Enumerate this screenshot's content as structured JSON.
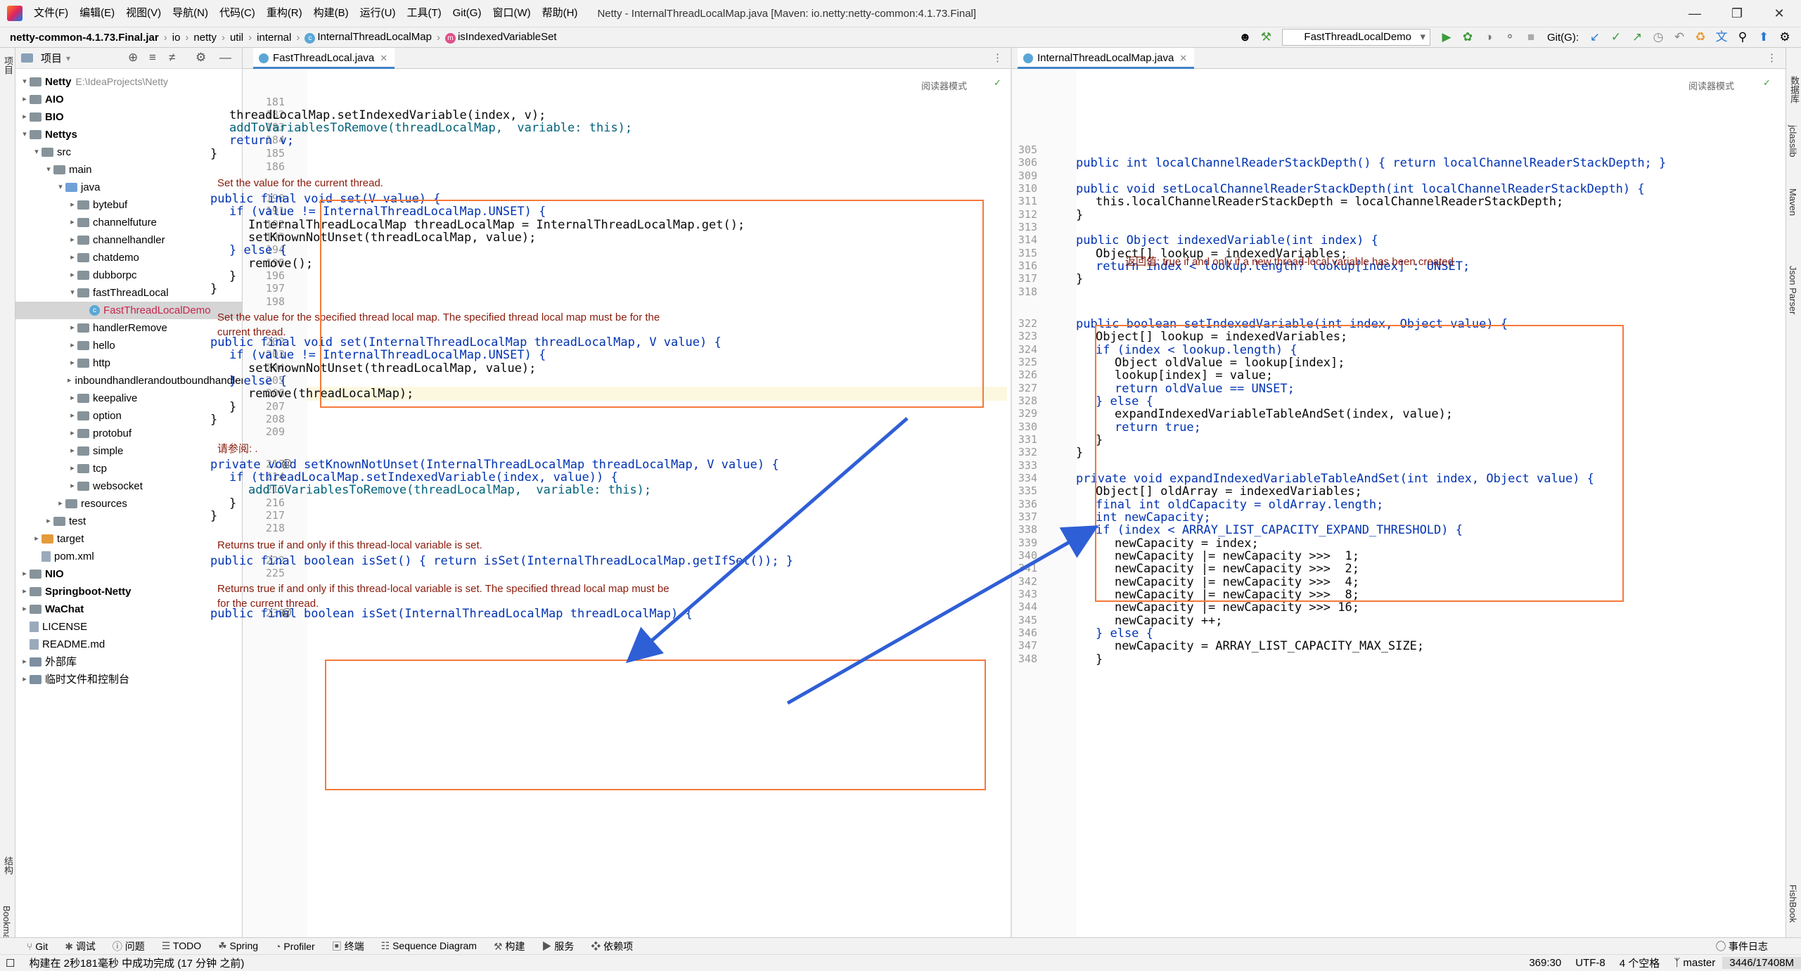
{
  "menubar": {
    "items": [
      "文件(F)",
      "编辑(E)",
      "视图(V)",
      "导航(N)",
      "代码(C)",
      "重构(R)",
      "构建(B)",
      "运行(U)",
      "工具(T)",
      "Git(G)",
      "窗口(W)",
      "帮助(H)"
    ],
    "title": "Netty - InternalThreadLocalMap.java [Maven: io.netty:netty-common:4.1.73.Final]"
  },
  "breadcrumb": [
    "netty-common-4.1.73.Final.jar",
    "io",
    "netty",
    "util",
    "internal",
    "InternalThreadLocalMap",
    "isIndexedVariableSet"
  ],
  "toolbar": {
    "run_config": "FastThreadLocalDemo",
    "git_label": "Git(G):"
  },
  "project": {
    "header": "项目",
    "tree": [
      {
        "t": "Netty",
        "path": "E:\\IdeaProjects\\Netty",
        "bold": true
      },
      {
        "t": "AIO",
        "bold": true
      },
      {
        "t": "BIO",
        "bold": true
      },
      {
        "t": "Nettys",
        "bold": true
      },
      {
        "t": "src"
      },
      {
        "t": "main"
      },
      {
        "t": "java"
      },
      {
        "t": "bytebuf"
      },
      {
        "t": "channelfuture"
      },
      {
        "t": "channelhandler"
      },
      {
        "t": "chatdemo"
      },
      {
        "t": "dubborpc"
      },
      {
        "t": "fastThreadLocal"
      },
      {
        "t": "FastThreadLocalDemo"
      },
      {
        "t": "handlerRemove"
      },
      {
        "t": "hello"
      },
      {
        "t": "http"
      },
      {
        "t": "inboundhandlerandoutboundhandler"
      },
      {
        "t": "keepalive"
      },
      {
        "t": "option"
      },
      {
        "t": "protobuf"
      },
      {
        "t": "simple"
      },
      {
        "t": "tcp"
      },
      {
        "t": "websocket"
      },
      {
        "t": "resources"
      },
      {
        "t": "test"
      },
      {
        "t": "target"
      },
      {
        "t": "pom.xml"
      },
      {
        "t": "NIO",
        "bold": true
      },
      {
        "t": "Springboot-Netty",
        "bold": true
      },
      {
        "t": "WaChat",
        "bold": true
      },
      {
        "t": "LICENSE"
      },
      {
        "t": "README.md"
      },
      {
        "t": "外部库"
      },
      {
        "t": "临时文件和控制台"
      }
    ]
  },
  "left_editor": {
    "tab": "FastThreadLocal.java",
    "reader": "阅读器模式",
    "line_numbers": [
      "181",
      "182",
      "183",
      "184",
      "185",
      "186",
      "190",
      "191",
      "192",
      "193",
      "194",
      "195",
      "196",
      "197",
      "198",
      "202",
      "203",
      "204",
      "205",
      "206",
      "207",
      "208",
      "209",
      "213",
      "214",
      "215",
      "216",
      "217",
      "218",
      "222",
      "225",
      "230"
    ],
    "docs": [
      "Set the value for the current thread.",
      "Set the value for the specified thread local map. The specified thread local map must be for the\ncurrent thread.",
      "请参阅: .",
      "Returns true if and only if this thread-local variable is set.",
      "Returns true if and only if this thread-local variable is set. The specified thread local map must be\nfor the current thread."
    ],
    "code": [
      "threadLocalMap.setIndexedVariable(index, v);",
      "addToVariablesToRemove(threadLocalMap,  variable: this);",
      "return v;",
      "}",
      "public final void set(V value) {",
      "if (value != InternalThreadLocalMap.UNSET) {",
      "InternalThreadLocalMap threadLocalMap = InternalThreadLocalMap.get();",
      "setKnownNotUnset(threadLocalMap, value);",
      "} else {",
      "remove();",
      "}",
      "}",
      "public final void set(InternalThreadLocalMap threadLocalMap, V value) {",
      "if (value != InternalThreadLocalMap.UNSET) {",
      "setKnownNotUnset(threadLocalMap, value);",
      "} else {",
      "remove(threadLocalMap);",
      "}",
      "}",
      "private void setKnownNotUnset(InternalThreadLocalMap threadLocalMap, V value) {",
      "if (threadLocalMap.setIndexedVariable(index, value)) {",
      "addToVariablesToRemove(threadLocalMap,  variable: this);",
      "}",
      "}",
      "public final boolean isSet() { return isSet(InternalThreadLocalMap.getIfSet()); }",
      "public final boolean isSet(InternalThreadLocalMap threadLocalMap) {"
    ]
  },
  "right_editor": {
    "tab": "InternalThreadLocalMap.java",
    "reader": "阅读器模式",
    "line_numbers": [
      "305",
      "306",
      "309",
      "310",
      "311",
      "312",
      "313",
      "314",
      "315",
      "316",
      "317",
      "318",
      "322",
      "323",
      "324",
      "325",
      "326",
      "327",
      "328",
      "329",
      "330",
      "331",
      "332",
      "333",
      "334",
      "335",
      "336",
      "337",
      "338",
      "339",
      "340",
      "341",
      "342",
      "343",
      "344",
      "345",
      "346",
      "347",
      "348"
    ],
    "doc": "返回值: true if and only if a new thread-local variable has been created",
    "code": [
      "public int localChannelReaderStackDepth() { return localChannelReaderStackDepth; }",
      "public void setLocalChannelReaderStackDepth(int localChannelReaderStackDepth) {",
      "this.localChannelReaderStackDepth = localChannelReaderStackDepth;",
      "}",
      "public Object indexedVariable(int index) {",
      "Object[] lookup = indexedVariables;",
      "return index < lookup.length? lookup[index] : UNSET;",
      "}",
      "public boolean setIndexedVariable(int index, Object value) {",
      "Object[] lookup = indexedVariables;",
      "if (index < lookup.length) {",
      "Object oldValue = lookup[index];",
      "lookup[index] = value;",
      "return oldValue == UNSET;",
      "} else {",
      "expandIndexedVariableTableAndSet(index, value);",
      "return true;",
      "}",
      "}",
      "private void expandIndexedVariableTableAndSet(int index, Object value) {",
      "Object[] oldArray = indexedVariables;",
      "final int oldCapacity = oldArray.length;",
      "int newCapacity;",
      "if (index < ARRAY_LIST_CAPACITY_EXPAND_THRESHOLD) {",
      "newCapacity = index;",
      "newCapacity |= newCapacity >>>  1;",
      "newCapacity |= newCapacity >>>  2;",
      "newCapacity |= newCapacity >>>  4;",
      "newCapacity |= newCapacity >>>  8;",
      "newCapacity |= newCapacity >>> 16;",
      "newCapacity ++;",
      "} else {",
      "newCapacity = ARRAY_LIST_CAPACITY_MAX_SIZE;",
      "}"
    ]
  },
  "bottom_tools": [
    "Git",
    "调试",
    "问题",
    "TODO",
    "Spring",
    "Profiler",
    "终端",
    "Sequence Diagram",
    "构建",
    "服务",
    "依赖项"
  ],
  "right_tools": [
    "数据库",
    "jclasslib",
    "Maven",
    "Json Parser",
    "FishBook"
  ],
  "left_tools": [
    "项目",
    "结构",
    "Bookmarks"
  ],
  "status": {
    "message": "构建在 2秒181毫秒 中成功完成 (17 分钟 之前)",
    "event_log": "事件日志",
    "position": "369:30",
    "encoding": "UTF-8",
    "indent": "4 个空格",
    "branch": "master",
    "memory": "3446/17408M"
  },
  "colors": {
    "annotation_box": "#f5793a",
    "arrow": "#2f5fd6",
    "keyword": "#0033b3",
    "doc": "#8a1b0c"
  }
}
